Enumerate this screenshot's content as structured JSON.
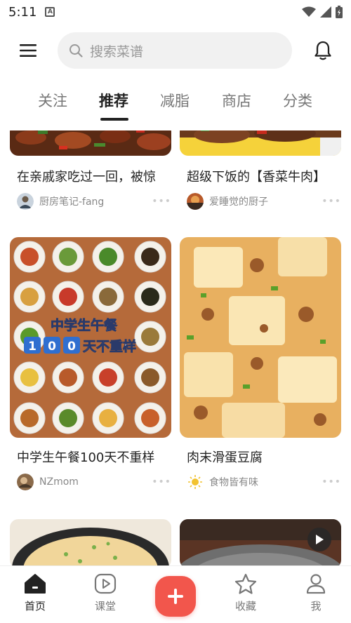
{
  "status_bar": {
    "time": "5:11",
    "app_indicator": "A"
  },
  "search": {
    "placeholder": "搜索菜谱"
  },
  "tabs": [
    {
      "label": "关注",
      "active": false
    },
    {
      "label": "推荐",
      "active": true
    },
    {
      "label": "减脂",
      "active": false
    },
    {
      "label": "商店",
      "active": false
    },
    {
      "label": "分类",
      "active": false
    }
  ],
  "feed": [
    {
      "title": "在亲戚家吃过一回，被惊",
      "author": "厨房笔记-fang",
      "more": "•••"
    },
    {
      "title": "超级下饭的【香菜牛肉】",
      "author": "爱睡觉的厨子",
      "more": "•••"
    },
    {
      "title": "中学生午餐100天不重样",
      "author": "NZmom",
      "more": "•••",
      "overlay_line1": "中学生午餐",
      "overlay_line2": "100天不重样"
    },
    {
      "title": "肉末滑蛋豆腐",
      "author": "食物皆有味",
      "more": "•••"
    }
  ],
  "bottom_nav": [
    {
      "label": "首页",
      "icon": "home-icon",
      "active": true
    },
    {
      "label": "课堂",
      "icon": "play-icon",
      "active": false
    },
    {
      "label": "收藏",
      "icon": "star-icon",
      "active": false
    },
    {
      "label": "我",
      "icon": "person-icon",
      "active": false
    }
  ],
  "colors": {
    "accent": "#f2564c",
    "text": "#222222",
    "muted": "#888888"
  }
}
